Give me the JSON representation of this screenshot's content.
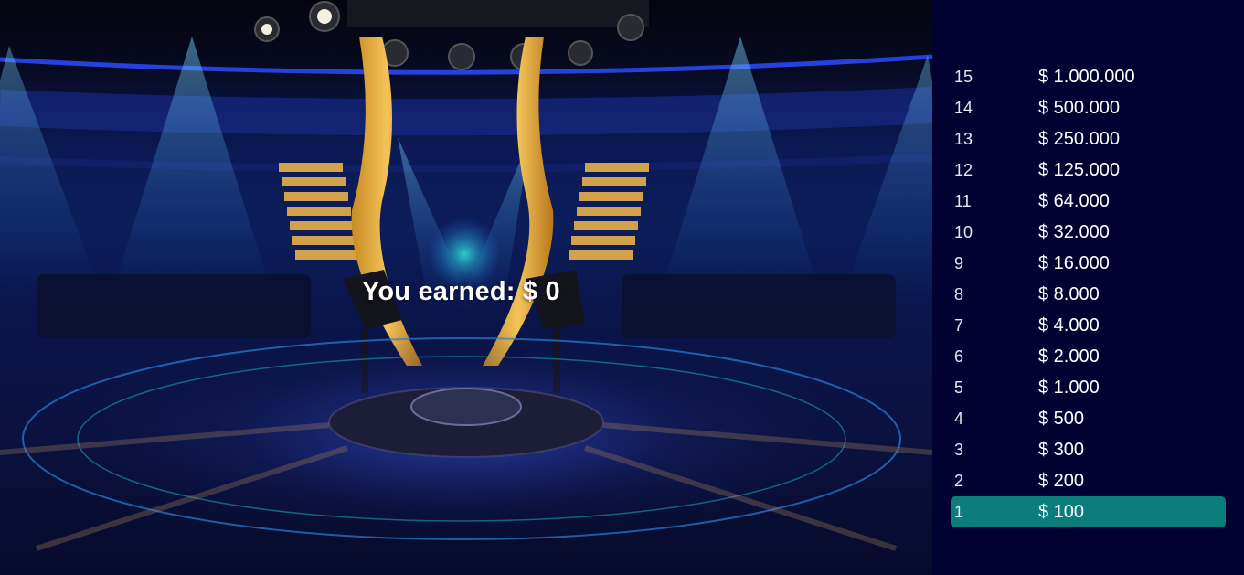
{
  "stage": {
    "earned_label": "You earned:",
    "earned_amount": "$ 0"
  },
  "pyramid": {
    "active_level": 1,
    "active_color": "#0b7d7a",
    "levels": [
      {
        "number": "15",
        "amount": "$ 1.000.000"
      },
      {
        "number": "14",
        "amount": "$ 500.000"
      },
      {
        "number": "13",
        "amount": "$ 250.000"
      },
      {
        "number": "12",
        "amount": "$ 125.000"
      },
      {
        "number": "11",
        "amount": "$ 64.000"
      },
      {
        "number": "10",
        "amount": "$ 32.000"
      },
      {
        "number": "9",
        "amount": "$ 16.000"
      },
      {
        "number": "8",
        "amount": "$ 8.000"
      },
      {
        "number": "7",
        "amount": "$ 4.000"
      },
      {
        "number": "6",
        "amount": "$ 2.000"
      },
      {
        "number": "5",
        "amount": "$ 1.000"
      },
      {
        "number": "4",
        "amount": "$ 500"
      },
      {
        "number": "3",
        "amount": "$ 300"
      },
      {
        "number": "2",
        "amount": "$ 200"
      },
      {
        "number": "1",
        "amount": "$ 100"
      }
    ]
  }
}
